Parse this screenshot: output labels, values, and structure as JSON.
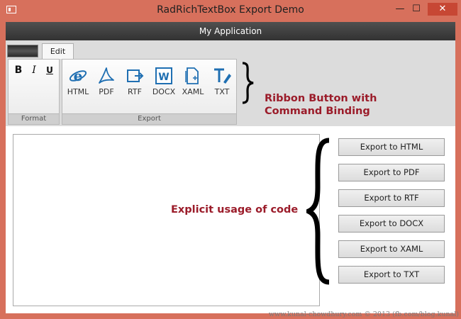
{
  "window": {
    "title": "RadRichTextBox Export Demo",
    "controls": {
      "minimize": "—",
      "maximize": "☐",
      "close": "✕"
    }
  },
  "app_header": {
    "title": "My Application"
  },
  "ribbon": {
    "tab": "Edit",
    "groups": {
      "format": {
        "label": "Format",
        "bold": "B",
        "italic": "I",
        "underline": "U"
      },
      "export": {
        "label": "Export",
        "buttons": [
          {
            "label": "HTML",
            "icon": "ie-icon"
          },
          {
            "label": "PDF",
            "icon": "pdf-icon"
          },
          {
            "label": "RTF",
            "icon": "rtf-icon"
          },
          {
            "label": "DOCX",
            "icon": "word-icon"
          },
          {
            "label": "XAML",
            "icon": "xaml-icon"
          },
          {
            "label": "TXT",
            "icon": "txt-icon"
          }
        ]
      }
    },
    "annotation_line1": "Ribbon Button with",
    "annotation_line2": "Command Binding"
  },
  "main": {
    "annotation": "Explicit usage of code",
    "buttons": [
      "Export to HTML",
      "Export to PDF",
      "Export to RTF",
      "Export to DOCX",
      "Export to XAML",
      "Export to TXT"
    ]
  },
  "watermark": "www.kunal-chowdhury.com © 2013 (fb.com/blog.kunal)",
  "colors": {
    "frame": "#d7705c",
    "annotation": "#9b1c2a",
    "icon": "#1f6fb2"
  }
}
